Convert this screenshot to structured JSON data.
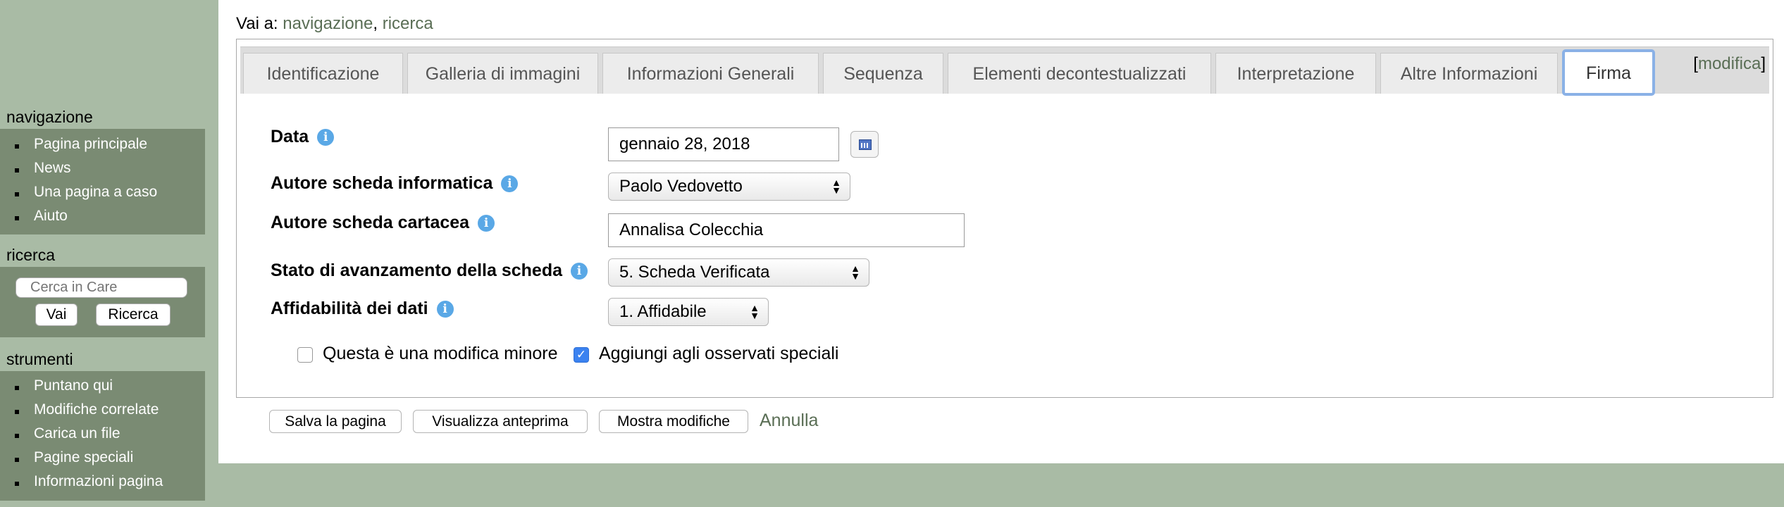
{
  "sidebar": {
    "navigation": {
      "title": "navigazione",
      "items": [
        "Pagina principale",
        "News",
        "Una pagina a caso",
        "Aiuto"
      ]
    },
    "search": {
      "title": "ricerca",
      "placeholder": "Cerca in Care",
      "go_label": "Vai",
      "search_label": "Ricerca"
    },
    "tools": {
      "title": "strumenti",
      "items": [
        "Puntano qui",
        "Modifiche correlate",
        "Carica un file",
        "Pagine speciali",
        "Informazioni pagina"
      ]
    }
  },
  "jump": {
    "prefix": "Vai a:",
    "navigation_link": "navigazione",
    "separator": ",",
    "search_link": "ricerca"
  },
  "tabs": [
    "Identificazione",
    "Galleria di immagini",
    "Informazioni Generali",
    "Sequenza",
    "Elementi decontestualizzati",
    "Interpretazione",
    "Altre Informazioni",
    "Firma"
  ],
  "active_tab": "Firma",
  "edit": {
    "open": "[",
    "label": "modifica",
    "close": "]"
  },
  "form": {
    "date": {
      "label": "Data",
      "value": "gennaio 28, 2018"
    },
    "author_digital": {
      "label": "Autore scheda informatica",
      "value": "Paolo Vedovetto"
    },
    "author_paper": {
      "label": "Autore scheda cartacea",
      "value": "Annalisa Colecchia"
    },
    "status": {
      "label": "Stato di avanzamento della scheda",
      "value": "5. Scheda Verificata"
    },
    "reliability": {
      "label": "Affidabilità dei dati",
      "value": "1. Affidabile"
    },
    "info_glyph": "i",
    "minor_edit": {
      "label": "Questa è una modifica minore",
      "checked": false
    },
    "watch": {
      "label": "Aggiungi agli osservati speciali",
      "checked": true,
      "check_glyph": "✓"
    }
  },
  "actions": {
    "save": "Salva la pagina",
    "preview": "Visualizza anteprima",
    "diff": "Mostra modifiche",
    "cancel": "Annulla"
  },
  "select_arrows": {
    "up": "▲",
    "down": "▼"
  },
  "colors": {
    "background": "#a9bba5",
    "sidebar_panel": "#7a8b73",
    "link": "#5a6e55",
    "active_tab_border": "#8ab1e6",
    "info_icon": "#5aa8e6",
    "checkbox_checked": "#3b82f0"
  }
}
